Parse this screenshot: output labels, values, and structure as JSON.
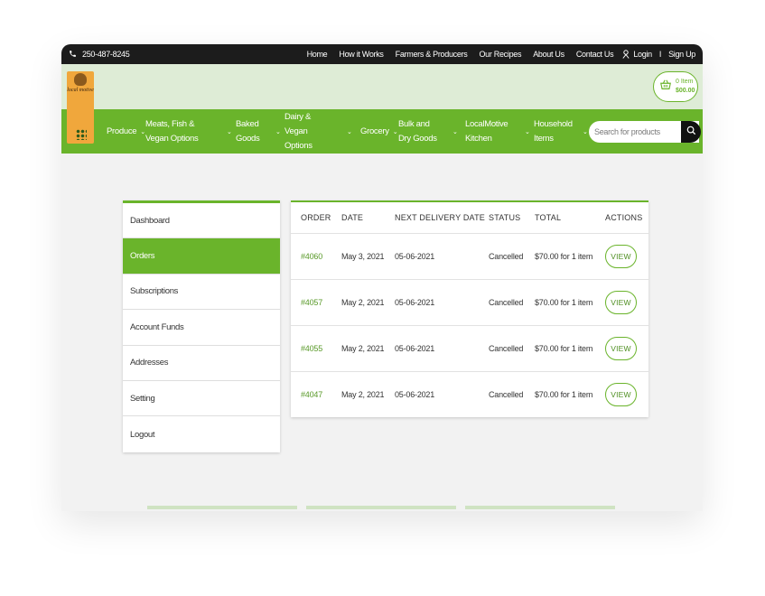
{
  "topbar": {
    "phone": "250-487-8245",
    "links": [
      "Home",
      "How it Works",
      "Farmers & Producers",
      "Our Recipes",
      "About Us",
      "Contact Us"
    ],
    "login": "Login",
    "separator": "I",
    "signup": "Sign Up"
  },
  "logo": {
    "text": "local motive"
  },
  "cart": {
    "items": "0 Item",
    "amount": "$00.00"
  },
  "nav": [
    {
      "label": "Produce"
    },
    {
      "label": "Meats, Fish & Vegan Options"
    },
    {
      "label": "Baked Goods"
    },
    {
      "label": "Dairy & Vegan Options"
    },
    {
      "label": "Grocery"
    },
    {
      "label": "Bulk and Dry Goods"
    },
    {
      "label": "LocalMotive Kitchen"
    },
    {
      "label": "Household Items"
    }
  ],
  "search": {
    "placeholder": "Search for products"
  },
  "sidebar": {
    "items": [
      "Dashboard",
      "Orders",
      "Subscriptions",
      "Account Funds",
      "Addresses",
      "Setting",
      "Logout"
    ],
    "active": "Orders"
  },
  "orders": {
    "headers": [
      "ORDER",
      "DATE",
      "NEXT DELIVERY DATE",
      "STATUS",
      "TOTAL",
      "ACTIONS"
    ],
    "rows": [
      {
        "order": "#4060",
        "date": "May 3, 2021",
        "next": "05-06-2021",
        "status": "Cancelled",
        "total": "$70.00 for 1 item",
        "action": "VIEW"
      },
      {
        "order": "#4057",
        "date": "May 2, 2021",
        "next": "05-06-2021",
        "status": "Cancelled",
        "total": "$70.00 for 1 item",
        "action": "VIEW"
      },
      {
        "order": "#4055",
        "date": "May 2, 2021",
        "next": "05-06-2021",
        "status": "Cancelled",
        "total": "$70.00 for 1 item",
        "action": "VIEW"
      },
      {
        "order": "#4047",
        "date": "May 2, 2021",
        "next": "05-06-2021",
        "status": "Cancelled",
        "total": "$70.00 for 1 item",
        "action": "VIEW"
      }
    ]
  },
  "colors": {
    "brand_green": "#6ab42b",
    "topbar": "#1c1c1c",
    "logo_band": "#deecd6",
    "logo_orange": "#f0a73c"
  }
}
